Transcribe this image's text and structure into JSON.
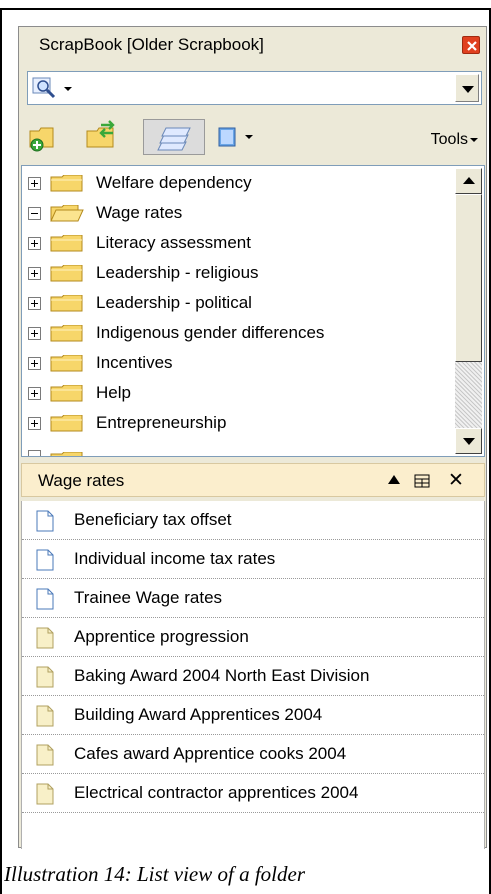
{
  "window": {
    "title": "ScrapBook [Older Scrapbook]"
  },
  "toolbar": {
    "tools_label": "Tools"
  },
  "tree": {
    "items": [
      {
        "label": "Welfare dependency",
        "expanded": false
      },
      {
        "label": "Wage rates",
        "expanded": true
      },
      {
        "label": "Literacy assessment",
        "expanded": false
      },
      {
        "label": "Leadership - religious",
        "expanded": false
      },
      {
        "label": "Leadership - political",
        "expanded": false
      },
      {
        "label": "Indigenous gender differences",
        "expanded": false
      },
      {
        "label": "Incentives",
        "expanded": false
      },
      {
        "label": "Help",
        "expanded": false
      },
      {
        "label": "Entrepreneurship",
        "expanded": false
      }
    ]
  },
  "list": {
    "title": "Wage rates",
    "items": [
      {
        "label": "Beneficiary tax offset",
        "icon": "blank-document-icon"
      },
      {
        "label": "Individual income tax rates",
        "icon": "blank-document-icon"
      },
      {
        "label": "Trainee Wage rates",
        "icon": "blank-document-icon"
      },
      {
        "label": "Apprentice progression",
        "icon": "note-document-icon"
      },
      {
        "label": "Baking Award 2004 North East Division",
        "icon": "note-document-icon"
      },
      {
        "label": "Building Award Apprentices 2004",
        "icon": "note-document-icon"
      },
      {
        "label": "Cafes award Apprentice cooks 2004",
        "icon": "note-document-icon"
      },
      {
        "label": "Electrical contractor apprentices 2004",
        "icon": "note-document-icon"
      }
    ]
  },
  "caption": "Illustration 14: List view of a folder",
  "colors": {
    "panel_bg": "#ece9d8",
    "header_bg": "#fbeecd",
    "close_red": "#e0401f",
    "folder_yellow": "#f7d66a"
  }
}
